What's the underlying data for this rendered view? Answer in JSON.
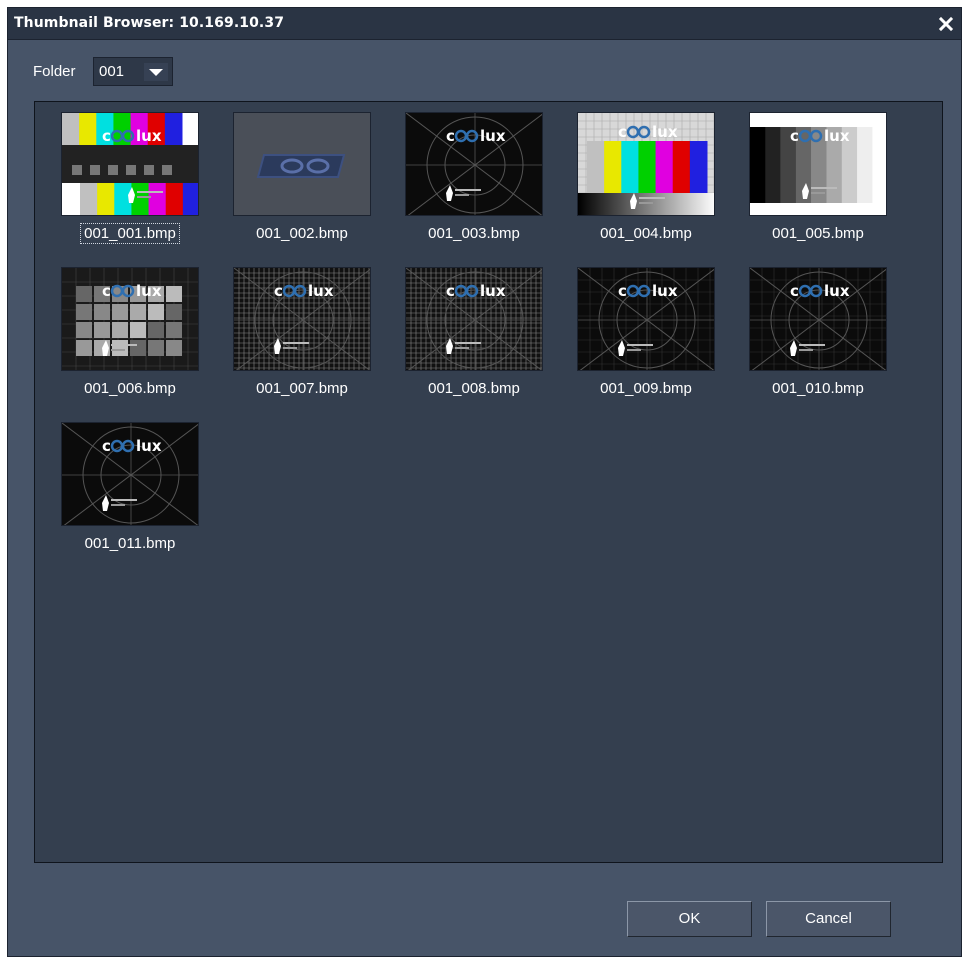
{
  "window": {
    "title": "Thumbnail Browser: 10.169.10.37",
    "close_icon": "close-icon"
  },
  "folder": {
    "label": "Folder",
    "selected": "001"
  },
  "thumbnails": [
    {
      "filename": "001_001.bmp",
      "pattern": "colorbars-split",
      "focused": true
    },
    {
      "filename": "001_002.bmp",
      "pattern": "logo-dark"
    },
    {
      "filename": "001_003.bmp",
      "pattern": "circle-crosshatch"
    },
    {
      "filename": "001_004.bmp",
      "pattern": "colorbars-gradient"
    },
    {
      "filename": "001_005.bmp",
      "pattern": "grayscale-bars"
    },
    {
      "filename": "001_006.bmp",
      "pattern": "gray-squares"
    },
    {
      "filename": "001_007.bmp",
      "pattern": "dense-grid"
    },
    {
      "filename": "001_008.bmp",
      "pattern": "dense-grid"
    },
    {
      "filename": "001_009.bmp",
      "pattern": "circle-grid"
    },
    {
      "filename": "001_010.bmp",
      "pattern": "circle-grid"
    },
    {
      "filename": "001_011.bmp",
      "pattern": "circle-crosshatch"
    }
  ],
  "buttons": {
    "ok": "OK",
    "cancel": "Cancel"
  },
  "colors": {
    "window_bg": "#475468",
    "panel_bg": "#343f4f",
    "titlebar_bg": "#2a3444",
    "text": "#ffffff",
    "logo_accent": "#2f6fb0"
  }
}
